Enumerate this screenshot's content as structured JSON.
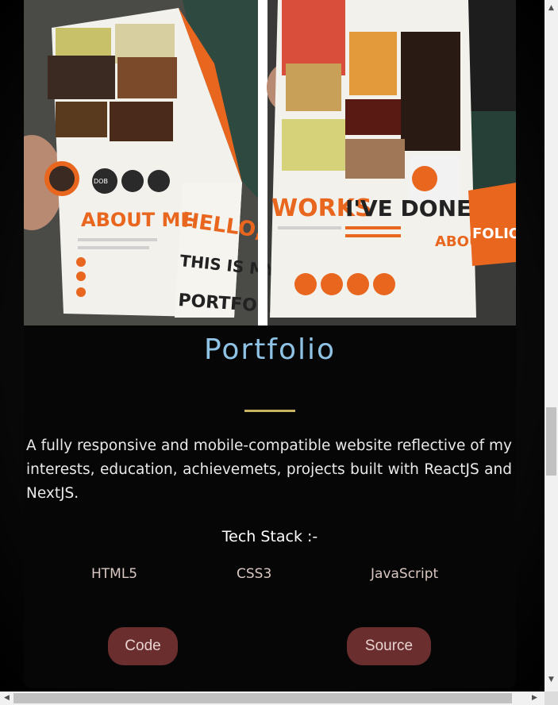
{
  "project": {
    "title": "Portfolio",
    "description": "A fully responsive and mobile-compatible website reflective of my interests, education, achievemets, projects built with ReactJS and NextJS.",
    "tech_stack_label": "Tech Stack :-",
    "tech_stack": [
      "HTML5",
      "CSS3",
      "JavaScript"
    ],
    "buttons": {
      "code": "Code",
      "source": "Source"
    },
    "image": {
      "left_panel": {
        "about": "ABOUT ME",
        "hello": "HELLO,",
        "this_is_my": "THIS IS MY",
        "portfolio": "PORTFOLIO",
        "dob": "DOB"
      },
      "right_panel": {
        "works": "WORKS",
        "ive_done": "I'VE DONE",
        "about": "ABOUT ME",
        "folio": "FOLIO"
      }
    }
  },
  "colors": {
    "title": "#8fc3e6",
    "divider": "#c8b360",
    "button_bg": "#6b2e2e",
    "accent_orange": "#e8661e"
  },
  "scrollbars": {
    "up_arrow": "▲",
    "down_arrow": "▼",
    "left_arrow": "◀",
    "right_arrow": "▶"
  }
}
